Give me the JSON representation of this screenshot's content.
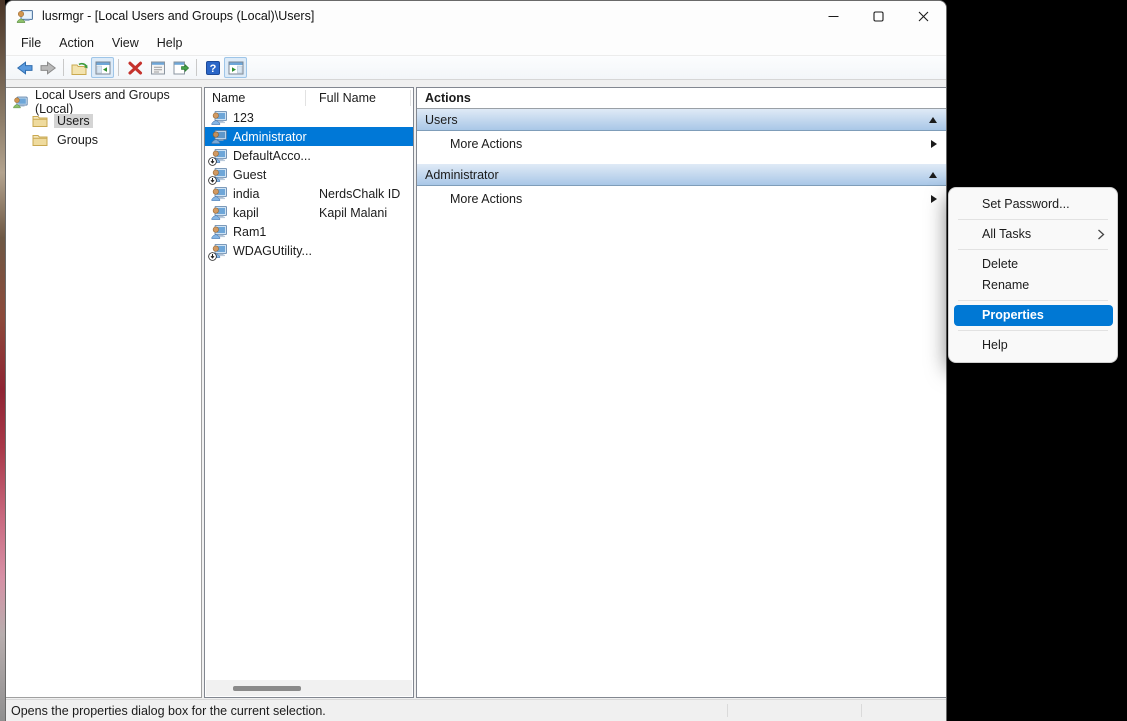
{
  "titlebar": {
    "title": "lusrmgr - [Local Users and Groups (Local)\\Users]",
    "controls": {
      "minimize": "minimize",
      "maximize": "maximize",
      "close": "close"
    }
  },
  "menubar": {
    "items": [
      "File",
      "Action",
      "View",
      "Help"
    ]
  },
  "toolbar": {
    "icons": [
      "back",
      "forward",
      "up-one-level",
      "show-hide-console-tree",
      "delete",
      "properties",
      "export-list",
      "help",
      "show-hide-action-pane"
    ]
  },
  "tree": {
    "root": "Local Users and Groups (Local)",
    "items": [
      {
        "label": "Users",
        "selected": true
      },
      {
        "label": "Groups",
        "selected": false
      }
    ]
  },
  "list": {
    "columns": [
      "Name",
      "Full Name"
    ],
    "rows": [
      {
        "name": "123",
        "full_name": "",
        "disabled": false,
        "selected": false
      },
      {
        "name": "Administrator",
        "full_name": "",
        "disabled": false,
        "selected": true
      },
      {
        "name": "DefaultAcco...",
        "full_name": "",
        "disabled": true,
        "selected": false
      },
      {
        "name": "Guest",
        "full_name": "",
        "disabled": true,
        "selected": false
      },
      {
        "name": "india",
        "full_name": "NerdsChalk ID",
        "disabled": false,
        "selected": false
      },
      {
        "name": "kapil",
        "full_name": "Kapil Malani",
        "disabled": false,
        "selected": false
      },
      {
        "name": "Ram1",
        "full_name": "",
        "disabled": false,
        "selected": false
      },
      {
        "name": "WDAGUtility...",
        "full_name": "",
        "disabled": true,
        "selected": false
      }
    ]
  },
  "actions": {
    "title": "Actions",
    "sections": [
      {
        "header": "Users",
        "items": [
          "More Actions"
        ]
      },
      {
        "header": "Administrator",
        "items": [
          "More Actions"
        ]
      }
    ]
  },
  "context_menu": {
    "items": [
      {
        "label": "Set Password...",
        "has_submenu": false,
        "highlighted": false
      },
      {
        "label": "All Tasks",
        "has_submenu": true,
        "highlighted": false
      },
      {
        "label": "Delete",
        "has_submenu": false,
        "highlighted": false
      },
      {
        "label": "Rename",
        "has_submenu": false,
        "highlighted": false
      },
      {
        "label": "Properties",
        "has_submenu": false,
        "highlighted": true
      },
      {
        "label": "Help",
        "has_submenu": false,
        "highlighted": false
      }
    ]
  },
  "statusbar": {
    "text": "Opens the properties dialog box for the current selection."
  },
  "colors": {
    "selection": "#0078d7",
    "menu_highlight": "#0078d4",
    "section_header_top": "#dfeaf6",
    "section_header_bottom": "#a9c7e7"
  }
}
